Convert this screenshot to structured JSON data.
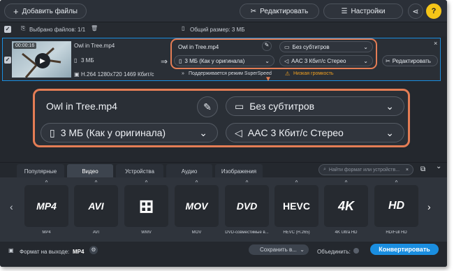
{
  "toolbar": {
    "add_files": "Добавить файлы",
    "edit": "Редактировать",
    "settings": "Настройки",
    "help": "?"
  },
  "subbar": {
    "selected": "Выбрано файлов: 1/1",
    "total_size": "Общий размер: 3 МБ"
  },
  "file": {
    "duration": "00:00:16",
    "name": "Owl in Tree.mp4",
    "size": "3 МБ",
    "info": "H.264 1280x720 1469 Кбит/с",
    "out_name": "Owl in Tree.mp4",
    "subtitles": "Без субтитров",
    "out_size": "3 МБ (Как у оригинала)",
    "audio": "AAC 3 Кбит/с Стерео",
    "edit": "Редактировать",
    "superspeed": "Поддерживается режим SuperSpeed",
    "warning": "Низкая громкость"
  },
  "zoom": {
    "name": "Owl in Tree.mp4",
    "subtitles": "Без субтитров",
    "size": "3 МБ (Как у оригинала)",
    "audio": "AAC 3 Кбит/с Стерео"
  },
  "tabs": [
    "Популярные",
    "Видео",
    "Устройства",
    "Аудио",
    "Изображения"
  ],
  "search": {
    "placeholder": "Найти формат или устройств..."
  },
  "formats": [
    {
      "logo": "MP4",
      "label": "MP4"
    },
    {
      "logo": "AVI",
      "label": "AVI"
    },
    {
      "logo": "⊞",
      "label": "WMV"
    },
    {
      "logo": "MOV",
      "label": "MOV"
    },
    {
      "logo": "DVD",
      "label": "DVD-совместимые в..."
    },
    {
      "logo": "HEVC",
      "label": "HEVC (H.265)"
    },
    {
      "logo": "4K",
      "label": "4K Ultra HD"
    },
    {
      "logo": "HD",
      "label": "HD/Full HD"
    }
  ],
  "footer": {
    "output_label": "Формат на выходе:",
    "output_value": "MP4",
    "save": "Сохранить в...",
    "join": "Объединить:",
    "convert": "Конвертировать"
  },
  "colors": {
    "accent": "#1a8ee0",
    "highlight": "#e47d55",
    "warning": "#f0a020"
  }
}
